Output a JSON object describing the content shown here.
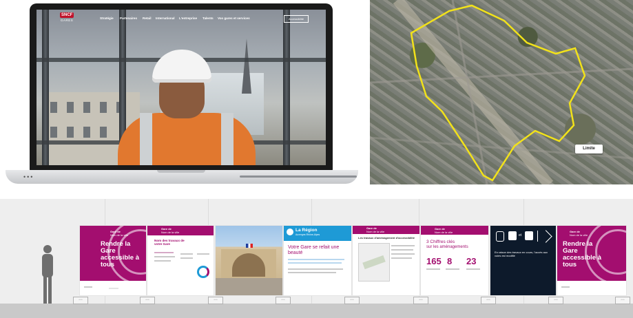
{
  "website": {
    "logo_badge": "SNCF",
    "logo_sub": "GARES",
    "nav": [
      "Stratégie",
      "Partenaires",
      "Retail",
      "International",
      "L'entreprise",
      "Talents",
      "Vos gares et services"
    ],
    "accessibility_button": "Accessibilité"
  },
  "map": {
    "label": "Limite"
  },
  "hoarding": {
    "station_tag": "Gare de",
    "city_tag": "Nom de la ville",
    "panel1_title": "Rendre la Gare accessible à tous",
    "panel2_title": "Nom des travaux de votre Gare",
    "panel4_brand": "La Région",
    "panel4_brand_sub": "Auvergne-Rhône-Alpes",
    "panel4_title": "Votre Gare se refait une beauté",
    "panel5_title": "Les travaux d'aménagement d'accessibilité",
    "panel6_title": "3 Chiffres clés",
    "panel6_subtitle": "sur les aménagements",
    "stats": [
      "165",
      "8",
      "23"
    ],
    "panel7_text": "En raison des travaux en cours, l'accès aux voies est modifié",
    "panel7_sep": "et",
    "panel8_title": "Rendre la Gare accessible à tous"
  },
  "colors": {
    "brand_magenta": "#a30e6f",
    "region_blue": "#1e9ad6",
    "dark_navy": "#0d1a2b",
    "map_outline": "#f2e21a"
  }
}
